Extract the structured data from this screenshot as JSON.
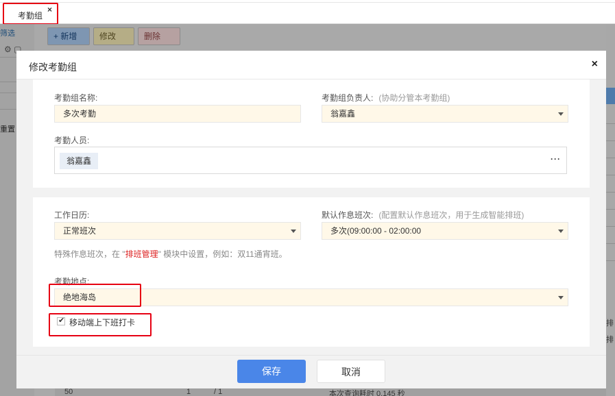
{
  "tab": {
    "label": "考勤组",
    "close": "×"
  },
  "background": {
    "left_filter": "筛选",
    "left_reset": "重置",
    "toolbar": {
      "add": "+ 新增",
      "edit": "修改",
      "delete": "删除"
    },
    "right_snippets": [
      "排",
      "排"
    ],
    "footer": {
      "page_size": "50",
      "page": "1",
      "total_pages": "/ 1",
      "query_time": "本次查询耗时 0.145 秒"
    }
  },
  "modal": {
    "title": "修改考勤组",
    "close": "×",
    "group_name": {
      "label": "考勤组名称:",
      "value": "多次考勤"
    },
    "owner": {
      "label": "考勤组负责人:",
      "hint": "(协助分管本考勤组)",
      "value": "翁嘉鑫"
    },
    "members": {
      "label": "考勤人员:",
      "tags": [
        "翁嘉鑫"
      ],
      "more": "···"
    },
    "calendar": {
      "label": "工作日历:",
      "value": "正常班次"
    },
    "default_shift": {
      "label": "默认作息班次:",
      "hint": "(配置默认作息班次，用于生成智能排班)",
      "value": "多次(09:00:00 - 02:00:00"
    },
    "special_hint": {
      "prefix": "特殊作息班次，在 \"",
      "link": "排班管理",
      "suffix": "\" 模块中设置，例如：双11通宵班。"
    },
    "location": {
      "label": "考勤地点:",
      "value": "绝地海岛"
    },
    "mobile_checkin": {
      "label": "移动端上下班打卡",
      "checked": true
    },
    "buttons": {
      "save": "保存",
      "cancel": "取消"
    }
  },
  "colors": {
    "primary": "#4a86e8",
    "highlight": "#e60012",
    "field_bg": "#fff8e8"
  }
}
